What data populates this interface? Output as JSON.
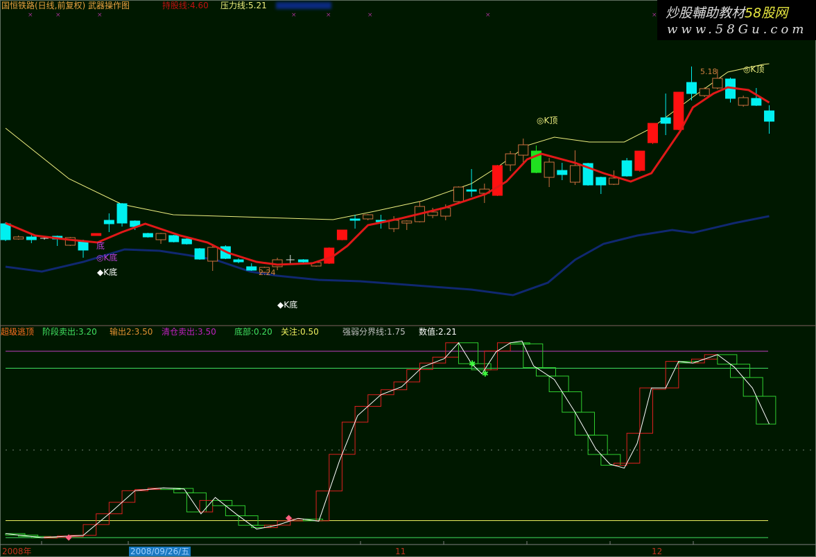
{
  "header": {
    "title": "国恒铁路(日线,前复权) 武器操作图",
    "hold_line": "持股线:4.60",
    "pressure_line": "压力线:5.21"
  },
  "watermark": {
    "line1_a": "炒股輔助教材",
    "line1_b": "58股网",
    "line2": "www.58Gu.com"
  },
  "lower_legend": {
    "name": "超级逃顶",
    "stage_sell": "阶段卖出:3.20",
    "output2": "输出2:3.50",
    "clear_sell": "清仓卖出:3.50",
    "bottom": "底部:0.20",
    "attention": "关注:0.50",
    "divider": "强弱分界线:1.75",
    "value": "数值:2.21"
  },
  "annotations": {
    "di": "底",
    "k_di_circle": "◎K底",
    "k_di_1": "◆K底",
    "k_di_2": "◆K底",
    "k_top_1": "◎K顶",
    "k_top_2": "◎K顶",
    "low_price": "2.24",
    "high_price": "5.18"
  },
  "date_axis": {
    "year": "2008年",
    "cursor_date": "2008/09/26/五",
    "m11": "11",
    "m12": "12"
  },
  "colors": {
    "bg": "#001800",
    "up_hollow": "#d07040",
    "up_solid": "#ff1010",
    "down": "#00f0f0",
    "limit_down": "#20e020",
    "ma": "#e01818",
    "upper_band": "#f0f080",
    "lower_band": "#102870"
  },
  "chart_data": [
    {
      "type": "candlestick",
      "title": "国恒铁路 日线",
      "ylim": [
        1.52,
        6.18
      ],
      "candles": [
        [
          2.95,
          2.97,
          2.7,
          2.72,
          "cyan"
        ],
        [
          2.73,
          2.78,
          2.72,
          2.76,
          "hollow"
        ],
        [
          2.76,
          2.82,
          2.67,
          2.72,
          "cyan"
        ],
        [
          2.74,
          2.76,
          2.72,
          2.74,
          "cross"
        ],
        [
          2.77,
          2.78,
          2.63,
          2.73,
          "cyan"
        ],
        [
          2.64,
          2.76,
          2.63,
          2.75,
          "hollow"
        ],
        [
          2.7,
          2.72,
          2.46,
          2.57,
          "cyan"
        ],
        [
          2.78,
          2.81,
          2.78,
          2.81,
          "red"
        ],
        [
          3.0,
          3.1,
          2.83,
          2.95,
          "cyan"
        ],
        [
          3.24,
          3.25,
          2.91,
          2.96,
          "cyan"
        ],
        [
          2.99,
          3.0,
          2.86,
          2.91,
          "cyan"
        ],
        [
          2.81,
          2.82,
          2.75,
          2.76,
          "cyan"
        ],
        [
          2.72,
          2.82,
          2.66,
          2.81,
          "hollow"
        ],
        [
          2.78,
          2.79,
          2.68,
          2.69,
          "cyan"
        ],
        [
          2.73,
          2.74,
          2.65,
          2.66,
          "cyan"
        ],
        [
          2.59,
          2.6,
          2.43,
          2.44,
          "cyan"
        ],
        [
          2.41,
          2.66,
          2.27,
          2.61,
          "hollow"
        ],
        [
          2.62,
          2.64,
          2.44,
          2.45,
          "cyan"
        ],
        [
          2.43,
          2.45,
          2.38,
          2.4,
          "cyan"
        ],
        [
          2.33,
          2.38,
          2.27,
          2.28,
          "cyan"
        ],
        [
          2.25,
          2.33,
          2.24,
          2.32,
          "hollow"
        ],
        [
          2.33,
          2.46,
          2.28,
          2.43,
          "hollow"
        ],
        [
          2.43,
          2.5,
          2.37,
          2.43,
          "cross"
        ],
        [
          2.43,
          2.44,
          2.39,
          2.4,
          "cyan"
        ],
        [
          2.34,
          2.4,
          2.33,
          2.39,
          "hollow"
        ],
        [
          2.38,
          2.61,
          2.37,
          2.6,
          "red"
        ],
        [
          2.72,
          2.86,
          2.71,
          2.86,
          "red"
        ],
        [
          3.02,
          3.08,
          2.88,
          3.0,
          "cyan"
        ],
        [
          3.02,
          3.09,
          3.0,
          3.08,
          "hollow"
        ],
        [
          3.0,
          3.08,
          2.88,
          2.98,
          "cyan"
        ],
        [
          2.88,
          3.06,
          2.83,
          3.0,
          "hollow"
        ],
        [
          2.96,
          3.0,
          2.86,
          2.99,
          "hollow"
        ],
        [
          2.98,
          3.28,
          2.97,
          3.2,
          "hollow"
        ],
        [
          3.07,
          3.18,
          3.03,
          3.12,
          "hollow"
        ],
        [
          3.06,
          3.23,
          3.0,
          3.18,
          "hollow"
        ],
        [
          3.27,
          3.49,
          3.26,
          3.48,
          "hollow"
        ],
        [
          3.44,
          3.74,
          3.34,
          3.43,
          "cyan"
        ],
        [
          3.39,
          3.53,
          3.25,
          3.45,
          "hollow"
        ],
        [
          3.36,
          3.8,
          3.35,
          3.79,
          "red"
        ],
        [
          3.8,
          4.0,
          3.71,
          3.96,
          "hollow"
        ],
        [
          3.94,
          4.18,
          3.82,
          4.09,
          "hollow"
        ],
        [
          4.0,
          4.08,
          3.68,
          3.69,
          "green"
        ],
        [
          3.62,
          3.9,
          3.48,
          3.84,
          "hollow"
        ],
        [
          3.72,
          3.83,
          3.58,
          3.66,
          "cyan"
        ],
        [
          3.55,
          4.01,
          3.51,
          3.79,
          "hollow"
        ],
        [
          3.82,
          3.83,
          3.5,
          3.51,
          "cyan"
        ],
        [
          3.62,
          3.63,
          3.38,
          3.51,
          "cyan"
        ],
        [
          3.52,
          3.72,
          3.51,
          3.61,
          "hollow"
        ],
        [
          3.86,
          3.9,
          3.63,
          3.64,
          "cyan"
        ],
        [
          3.72,
          4.0,
          3.7,
          4.0,
          "red"
        ],
        [
          4.12,
          4.4,
          4.1,
          4.4,
          "red"
        ],
        [
          4.48,
          4.83,
          4.23,
          4.4,
          "cyan"
        ],
        [
          4.31,
          4.85,
          4.3,
          4.85,
          "red"
        ],
        [
          4.99,
          5.22,
          4.73,
          4.83,
          "cyan"
        ],
        [
          4.8,
          4.92,
          4.78,
          4.9,
          "hollow"
        ],
        [
          4.91,
          5.18,
          4.89,
          5.05,
          "hollow"
        ],
        [
          5.04,
          5.06,
          4.7,
          4.76,
          "cyan"
        ],
        [
          4.66,
          4.8,
          4.64,
          4.77,
          "hollow"
        ],
        [
          4.76,
          4.91,
          4.65,
          4.66,
          "cyan"
        ],
        [
          4.58,
          4.66,
          4.25,
          4.43,
          "cyan"
        ]
      ],
      "upper_band": [
        [
          0,
          4.33
        ],
        [
          4.9,
          3.6
        ],
        [
          9,
          3.23
        ],
        [
          12.96,
          3.08
        ],
        [
          18.3,
          3.05
        ],
        [
          25.3,
          3.01
        ],
        [
          28.5,
          3.13
        ],
        [
          32.2,
          3.28
        ],
        [
          36,
          3.53
        ],
        [
          38.1,
          3.78
        ],
        [
          40.3,
          4.08
        ],
        [
          42.4,
          4.2
        ],
        [
          45.1,
          4.13
        ],
        [
          47.8,
          4.13
        ],
        [
          49.9,
          4.33
        ],
        [
          53.1,
          4.78
        ],
        [
          55.8,
          5.14
        ],
        [
          58.5,
          5.25
        ],
        [
          59,
          5.26
        ]
      ],
      "ma": [
        [
          0,
          2.96
        ],
        [
          2.3,
          2.78
        ],
        [
          4.9,
          2.72
        ],
        [
          7.1,
          2.68
        ],
        [
          9,
          2.83
        ],
        [
          10.8,
          2.95
        ],
        [
          13.5,
          2.78
        ],
        [
          15.6,
          2.68
        ],
        [
          17.2,
          2.53
        ],
        [
          19.4,
          2.4
        ],
        [
          21,
          2.36
        ],
        [
          23.7,
          2.38
        ],
        [
          25.3,
          2.48
        ],
        [
          26.4,
          2.63
        ],
        [
          28,
          2.93
        ],
        [
          30.6,
          3.03
        ],
        [
          33.9,
          3.18
        ],
        [
          37.1,
          3.38
        ],
        [
          38.7,
          3.56
        ],
        [
          40.3,
          3.88
        ],
        [
          41.4,
          3.96
        ],
        [
          44,
          3.83
        ],
        [
          46.2,
          3.68
        ],
        [
          48.3,
          3.56
        ],
        [
          49.9,
          3.68
        ],
        [
          52.1,
          4.28
        ],
        [
          53.1,
          4.63
        ],
        [
          54.7,
          4.83
        ],
        [
          55.8,
          4.92
        ],
        [
          57.4,
          4.88
        ],
        [
          59,
          4.7
        ]
      ],
      "lower_band": [
        [
          0,
          2.33
        ],
        [
          2.8,
          2.26
        ],
        [
          6,
          2.4
        ],
        [
          9.2,
          2.58
        ],
        [
          11.9,
          2.56
        ],
        [
          14,
          2.5
        ],
        [
          16.2,
          2.43
        ],
        [
          18.9,
          2.26
        ],
        [
          21,
          2.2
        ],
        [
          24.2,
          2.14
        ],
        [
          27.4,
          2.12
        ],
        [
          31.7,
          2.06
        ],
        [
          36,
          2
        ],
        [
          39.2,
          1.92
        ],
        [
          41.9,
          2.1
        ],
        [
          44,
          2.43
        ],
        [
          46.2,
          2.66
        ],
        [
          48.8,
          2.78
        ],
        [
          51.5,
          2.86
        ],
        [
          53.1,
          2.82
        ],
        [
          56.3,
          2.96
        ],
        [
          59,
          3.06
        ]
      ]
    },
    {
      "type": "line",
      "title": "超级逃顶",
      "ylim": [
        0,
        3.8
      ],
      "levels": {
        "clear_sell": 3.5,
        "stage_sell": 3.2,
        "divider": 1.75,
        "attention": 0.5,
        "bottom": 0.2
      },
      "value_line": [
        [
          0,
          0.27
        ],
        [
          2.8,
          0.2
        ],
        [
          6,
          0.24
        ],
        [
          8.1,
          0.64
        ],
        [
          10,
          1.03
        ],
        [
          12.2,
          1.08
        ],
        [
          13.8,
          1.06
        ],
        [
          15.1,
          0.62
        ],
        [
          16.2,
          0.91
        ],
        [
          17.8,
          0.62
        ],
        [
          19.4,
          0.35
        ],
        [
          21,
          0.42
        ],
        [
          22.6,
          0.54
        ],
        [
          24.2,
          0.49
        ],
        [
          25.8,
          1.56
        ],
        [
          27.2,
          2.36
        ],
        [
          29,
          2.73
        ],
        [
          30.6,
          2.87
        ],
        [
          32.2,
          3.22
        ],
        [
          33.9,
          3.37
        ],
        [
          35,
          3.65
        ],
        [
          36,
          3.28
        ],
        [
          36.8,
          3.1
        ],
        [
          37.9,
          3.49
        ],
        [
          39,
          3.65
        ],
        [
          39.9,
          3.68
        ],
        [
          40.8,
          3.24
        ],
        [
          42.4,
          3.0
        ],
        [
          44,
          2.42
        ],
        [
          45.6,
          1.77
        ],
        [
          46.7,
          1.5
        ],
        [
          47.8,
          1.43
        ],
        [
          48.8,
          1.87
        ],
        [
          49.9,
          2.85
        ],
        [
          51,
          2.85
        ],
        [
          52,
          3.32
        ],
        [
          53.1,
          3.29
        ],
        [
          55,
          3.44
        ],
        [
          56.3,
          3.22
        ],
        [
          57.7,
          2.85
        ],
        [
          59,
          2.21
        ]
      ],
      "buy_signals": [
        [
          4.9,
          0.2
        ],
        [
          21.9,
          0.54
        ]
      ],
      "sell_signals": [
        [
          36,
          3.28
        ],
        [
          37,
          3.1
        ]
      ]
    }
  ]
}
